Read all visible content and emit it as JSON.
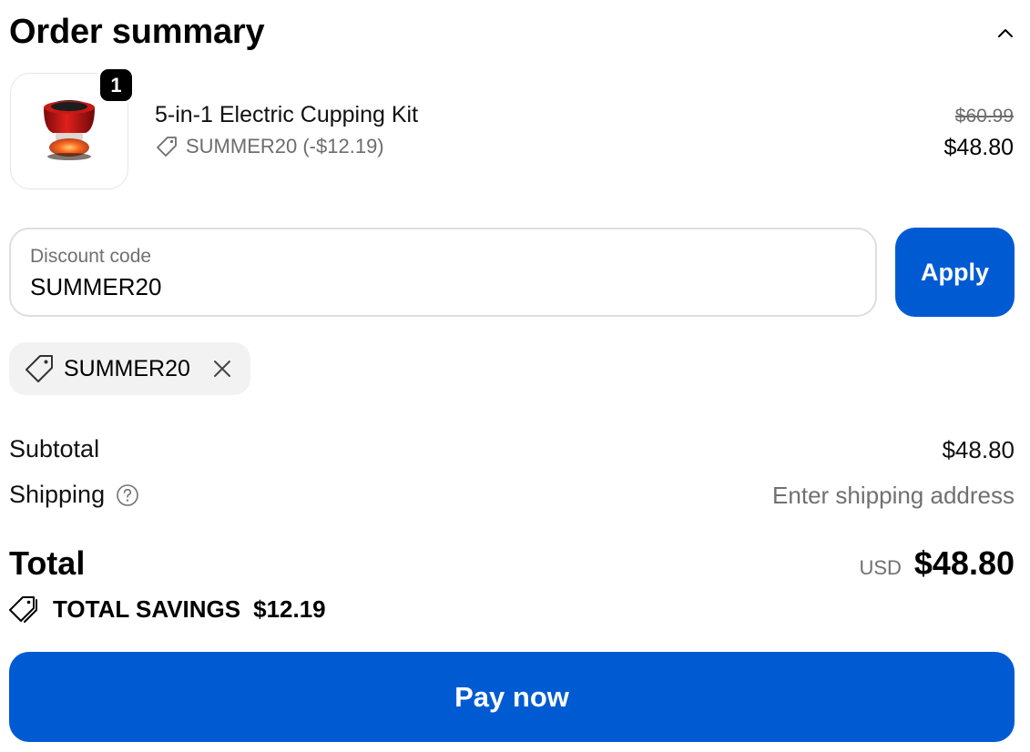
{
  "header": {
    "title": "Order summary",
    "toggle_icon": "chevron-up-icon"
  },
  "line_item": {
    "quantity": "1",
    "name": "5-in-1 Electric Cupping Kit",
    "discount_text": "SUMMER20 (-$12.19)",
    "original_price": "$60.99",
    "price": "$48.80",
    "image_icon": "electric-cupping-device"
  },
  "discount": {
    "label": "Discount code",
    "value": "SUMMER20",
    "apply_label": "Apply",
    "applied_code": "SUMMER20"
  },
  "summary": {
    "subtotal_label": "Subtotal",
    "subtotal_value": "$48.80",
    "shipping_label": "Shipping",
    "shipping_value": "Enter shipping address",
    "total_label": "Total",
    "currency": "USD",
    "total_value": "$48.80",
    "savings_label": "TOTAL SAVINGS",
    "savings_value": "$12.19"
  },
  "actions": {
    "pay_label": "Pay now"
  },
  "colors": {
    "accent": "#005bd3",
    "muted": "#707070",
    "chip_bg": "#f2f2f2"
  }
}
